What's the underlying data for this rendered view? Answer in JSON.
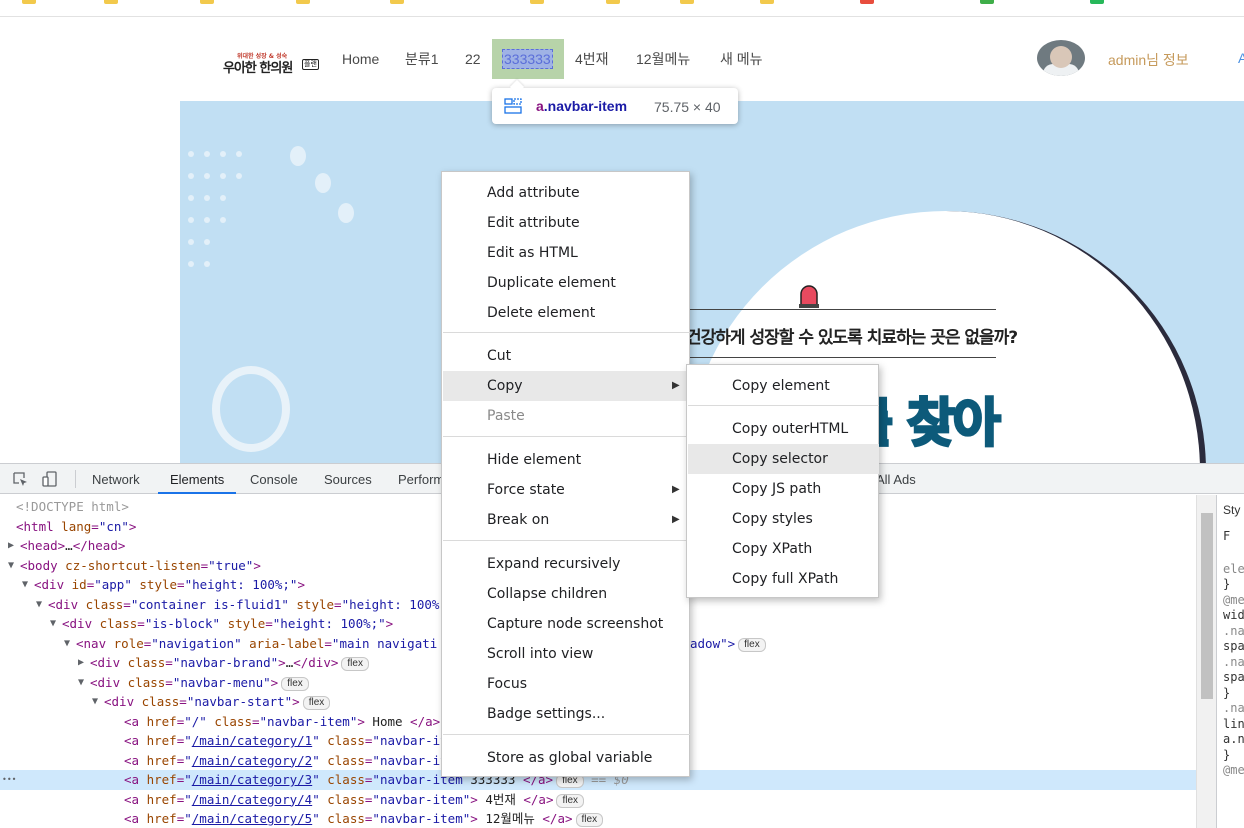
{
  "site_nav": {
    "items": [
      "Home",
      "분류1",
      "22",
      "333333",
      "4번재",
      "12월메뉴",
      "새 메뉴"
    ],
    "admin_label": "admin님 정보",
    "edge_label": "A",
    "logo_top": "위대한 성장 & 성숙",
    "logo_main": "우아한 한의원",
    "logo_tag": "플랜"
  },
  "inspect_tooltip": {
    "tag": "a",
    "class": ".navbar-item",
    "size": "75.75 × 40"
  },
  "banner": {
    "question": "건강하게 성장할 수 있도록 치료하는 곳은 없을까?",
    "big_text": "를 찾아"
  },
  "devtools": {
    "tabs": [
      "Network",
      "Elements",
      "Console",
      "Sources",
      "Perform",
      "All Ads"
    ],
    "active_tab": "Elements",
    "badge": "flex",
    "eq": "== $0",
    "styles_lines": [
      "Sty",
      "F",
      "ele",
      "}",
      "@me",
      "wid",
      ".na",
      "spa",
      ".na",
      "spa",
      "}",
      ".na",
      "lin",
      "a.n",
      "}",
      "@me"
    ],
    "dom": [
      {
        "cm": "<!DOCTYPE html>"
      },
      {
        "open": "<html",
        "attrs": [
          [
            "lang",
            "\"cn\""
          ]
        ],
        "close": ">"
      },
      {
        "open": "<head>",
        "mid": "…",
        "end": "</head>"
      },
      {
        "open": "<body",
        "attrs": [
          [
            "cz-shortcut-listen",
            "\"true\""
          ]
        ],
        "close": ">"
      },
      {
        "open": "<div",
        "attrs": [
          [
            "id",
            "\"app\""
          ],
          [
            "style",
            "\"height: 100%;\""
          ]
        ],
        "close": ">"
      },
      {
        "open": "<div",
        "attrs": [
          [
            "class",
            "\"container is-fluid1\""
          ],
          [
            "style",
            "\"height: 100%"
          ]
        ],
        "close": ""
      },
      {
        "open": "<div",
        "attrs": [
          [
            "class",
            "\"is-block\""
          ],
          [
            "style",
            "\"height: 100%;\""
          ]
        ],
        "close": ">"
      },
      {
        "open": "<nav",
        "attrs": [
          [
            "role",
            "\"navigation\""
          ],
          [
            "aria-label",
            "\"main navigati"
          ]
        ],
        "close": "",
        "tail": "adow\">"
      },
      {
        "open": "<div",
        "attrs": [
          [
            "class",
            "\"navbar-brand\""
          ]
        ],
        "close": ">",
        "mid": "…",
        "end": "</div>"
      },
      {
        "open": "<div",
        "attrs": [
          [
            "class",
            "\"navbar-menu\""
          ]
        ],
        "close": ">"
      },
      {
        "open": "<div",
        "attrs": [
          [
            "class",
            "\"navbar-start\""
          ]
        ],
        "close": ">"
      },
      {
        "open": "<a",
        "attrs": [
          [
            "href",
            "\"/\""
          ],
          [
            "class",
            "\"navbar-item\""
          ]
        ],
        "close": ">",
        "text": " Home ",
        "end": "</a>"
      },
      {
        "open": "<a",
        "attrs": [
          [
            "href",
            "\"/main/category/1\""
          ],
          [
            "class",
            "\"navbar-it"
          ]
        ]
      },
      {
        "open": "<a",
        "attrs": [
          [
            "href",
            "\"/main/category/2\""
          ],
          [
            "class",
            "\"navbar-it"
          ]
        ]
      },
      {
        "open": "<a",
        "attrs": [
          [
            "href",
            "\"/main/category/3\""
          ],
          [
            "class",
            "\"navbar-item"
          ]
        ],
        "text": " 333333 ",
        "end": "</a>"
      },
      {
        "open": "<a",
        "attrs": [
          [
            "href",
            "\"/main/category/4\""
          ],
          [
            "class",
            "\"navbar-item\""
          ]
        ],
        "close": ">",
        "text": " 4번재 ",
        "end": "</a>"
      },
      {
        "open": "<a",
        "attrs": [
          [
            "href",
            "\"/main/category/5\""
          ],
          [
            "class",
            "\"navbar-item\""
          ]
        ],
        "close": ">",
        "text": " 12월메뉴 ",
        "end": "</a>"
      }
    ]
  },
  "context_menu": {
    "group1": [
      "Add attribute",
      "Edit attribute",
      "Edit as HTML",
      "Duplicate element",
      "Delete element"
    ],
    "group2": [
      "Cut",
      "Copy",
      "Paste"
    ],
    "group3": [
      "Hide element",
      "Force state",
      "Break on"
    ],
    "group4": [
      "Expand recursively",
      "Collapse children",
      "Capture node screenshot",
      "Scroll into view",
      "Focus",
      "Badge settings..."
    ],
    "group5": [
      "Store as global variable"
    ]
  },
  "copy_submenu": {
    "group1": [
      "Copy element"
    ],
    "group2": [
      "Copy outerHTML",
      "Copy selector",
      "Copy JS path",
      "Copy styles",
      "Copy XPath",
      "Copy full XPath"
    ]
  }
}
